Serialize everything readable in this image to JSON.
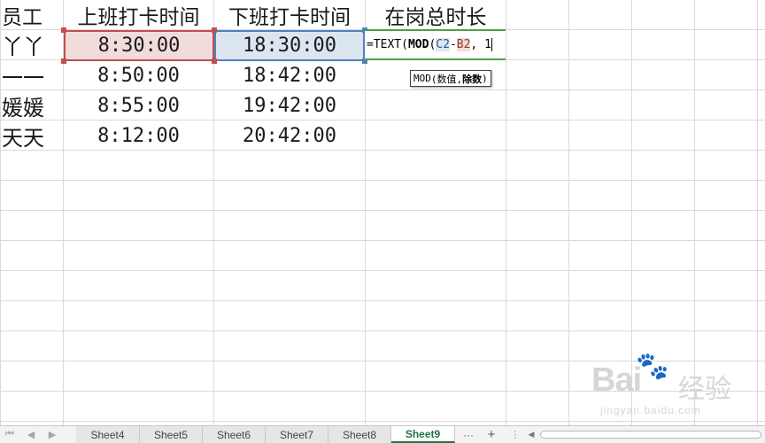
{
  "sheet": {
    "headers": [
      "员工",
      "上班打卡时间",
      "下班打卡时间",
      "在岗总时长"
    ],
    "rows": [
      {
        "name": "丫丫",
        "start": "8:30:00",
        "end": "18:30:00"
      },
      {
        "name": "一一",
        "start": "8:50:00",
        "end": "18:42:00"
      },
      {
        "name": "媛媛",
        "start": "8:55:00",
        "end": "19:42:00"
      },
      {
        "name": "天天",
        "start": "8:12:00",
        "end": "20:42:00"
      }
    ],
    "edit_cell": {
      "prefix": "=TEXT(",
      "func": "MOD",
      "paren_open": "(",
      "ref_c": "C2",
      "minus": "-",
      "ref_b": "B2",
      "rest": ", 1"
    },
    "tooltip": {
      "func": "MOD",
      "args_open": " (数值, ",
      "current_arg": "除数",
      "args_close": ")"
    }
  },
  "watermark": {
    "brand": "Bai",
    "jingyan": "经验",
    "url": "jingyan.baidu.com"
  },
  "tabs": {
    "items": [
      "Sheet4",
      "Sheet5",
      "Sheet6",
      "Sheet7",
      "Sheet8",
      "Sheet9"
    ],
    "active_index": 5,
    "more_label": "···",
    "add_label": "+"
  },
  "colors": {
    "accent": "#217346",
    "ref_b": "#c0504d",
    "ref_c": "#4f81bd",
    "edit_border": "#4aa147"
  }
}
